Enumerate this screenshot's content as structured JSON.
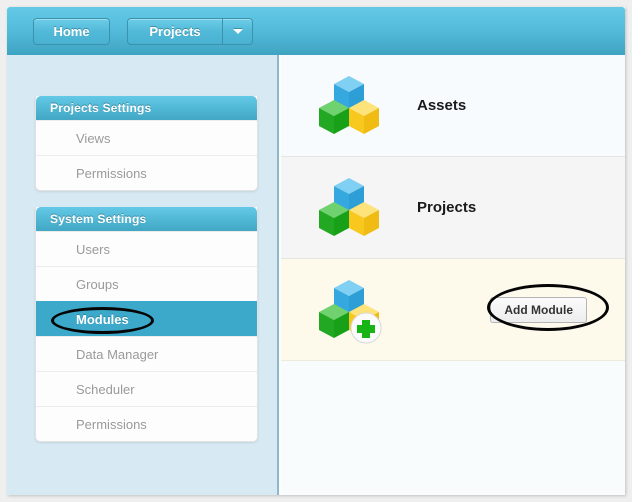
{
  "topbar": {
    "home_label": "Home",
    "projects_label": "Projects",
    "dropdown_icon": "chevron-down-icon",
    "gradient_top": "#63C9E6",
    "gradient_bottom": "#3FA4C2"
  },
  "sidebar": {
    "background": "#D7EAF3",
    "panels": [
      {
        "title": "Projects Settings",
        "items": [
          {
            "label": "Views",
            "selected": false
          },
          {
            "label": "Permissions",
            "selected": false
          }
        ]
      },
      {
        "title": "System Settings",
        "items": [
          {
            "label": "Users",
            "selected": false
          },
          {
            "label": "Groups",
            "selected": false
          },
          {
            "label": "Modules",
            "selected": true
          },
          {
            "label": "Data Manager",
            "selected": false
          },
          {
            "label": "Scheduler",
            "selected": false
          },
          {
            "label": "Permissions",
            "selected": false
          }
        ]
      }
    ],
    "selected_color": "#3CA9CA",
    "item_text_color": "#9A9A9A"
  },
  "main": {
    "rows": [
      {
        "label": "Assets",
        "icon": "cubes-icon",
        "background": "#F7FBFD",
        "has_button": false
      },
      {
        "label": "Projects",
        "icon": "cubes-icon",
        "background": "#F5F5F5",
        "has_button": false
      },
      {
        "label": "",
        "icon": "cubes-add-icon",
        "background": "#FDFAEC",
        "has_button": true,
        "button_label": "Add Module"
      }
    ]
  },
  "annotations": [
    {
      "target": "Modules",
      "shape": "ellipse",
      "color": "#050505"
    },
    {
      "target": "Add Module",
      "shape": "ellipse",
      "color": "#050505"
    }
  ],
  "icon_colors": {
    "cube_top": "#3BAEE8",
    "cube_left": "#35B838",
    "cube_right": "#FBCF2B",
    "plus_badge": "#16B414"
  }
}
